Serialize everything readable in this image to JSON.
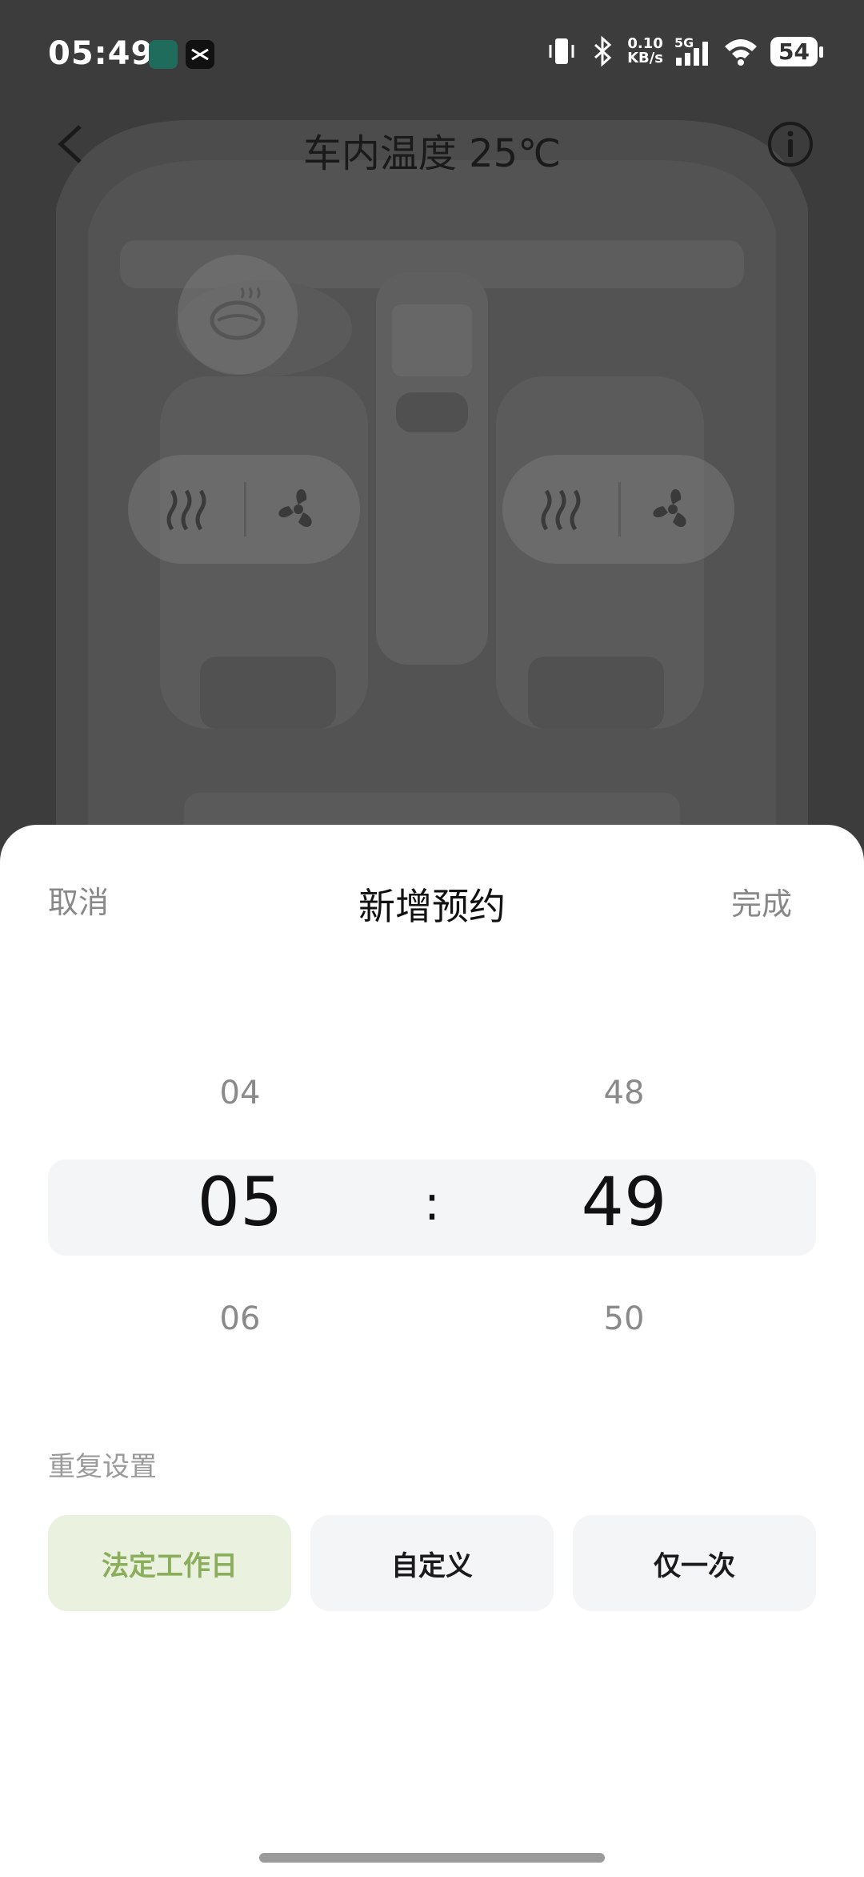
{
  "status_bar": {
    "time": "05:49",
    "net_speed_value": "0.10",
    "net_speed_unit": "KB/s",
    "network": "5G",
    "battery": "54"
  },
  "header": {
    "title": "车内温度 25℃"
  },
  "sheet": {
    "cancel_label": "取消",
    "title": "新增预约",
    "done_label": "完成",
    "picker": {
      "hour_prev": "04",
      "hour_selected": "05",
      "hour_next": "06",
      "separator": ":",
      "minute_prev": "48",
      "minute_selected": "49",
      "minute_next": "50"
    },
    "repeat_label": "重复设置",
    "repeat_options": [
      {
        "label": "法定工作日",
        "selected": true
      },
      {
        "label": "自定义",
        "selected": false
      },
      {
        "label": "仅一次",
        "selected": false
      }
    ]
  },
  "colors": {
    "accent_text": "#8aae5c",
    "accent_bg": "#eaf2df"
  }
}
